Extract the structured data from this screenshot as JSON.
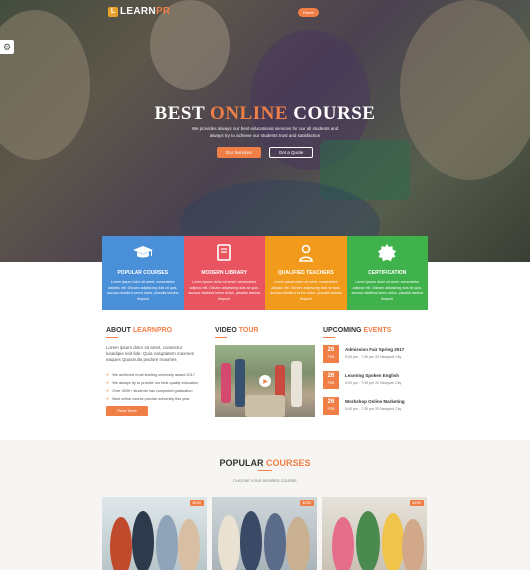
{
  "brand": {
    "mark": "L",
    "name_a": "LEARN",
    "name_b": "PR"
  },
  "nav": {
    "items": [
      "Home",
      "",
      "",
      ""
    ]
  },
  "settings_icon": "gear-icon",
  "hero": {
    "title_a": "BEST ",
    "title_highlight": "ONLINE",
    "title_b": " COURSE",
    "subtitle": "We provides always our best educational services for our all students and always try to achieve our students trust and satisfaction",
    "btn_primary": "Our Services",
    "btn_secondary": "Get a Quote"
  },
  "features": [
    {
      "title": "POPULAR COURSES",
      "icon": "graduation-cap-icon",
      "color": "#4a90d9",
      "text": "Lorem ipsum dolor sit amet, consectetur adipisic elit. Glicaec adipiscing duis sit quis, accusa nisidiera lorem dolos. pissalia lassina fimporit"
    },
    {
      "title": "MODERN LIBRARY",
      "icon": "book-icon",
      "color": "#e8545f",
      "text": "Lorem ipsum dolor sit amet, consectetur adipisic elit. Glicaec adipiscing duis sit quis, accusa nisidiera lorem dolos. pissalia lassina fimporit"
    },
    {
      "title": "QUALIFIED TEACHERS",
      "icon": "user-icon",
      "color": "#f29a1c",
      "text": "Lorem ipsum dolor sit amet, consectetur adipisic elit. Glicaec adipiscing duis sit quis, accusa nisidiera lorem dolos. pissalia lassina fimporit"
    },
    {
      "title": "CERTIFICATION",
      "icon": "badge-icon",
      "color": "#3fb24c",
      "text": "Lorem ipsum dolor sit amet, consectetur adipisic elit. Glicaec adipiscing duis sit quis, accusa nisidiera lorem dolos. pissalia lassina fimporit"
    }
  ],
  "about": {
    "title_a": "ABOUT ",
    "title_b": "LEARNPRO",
    "text": "Lorem ipsum dolor sit amet, consectur lusadipie enit lide. Quia voluptatem maxmes eaques Quasnulia pisdore maxmes",
    "list": [
      "We achieved most leading university award 2017",
      "We always try to provide our best quality education",
      "Over 3000+ students has completed graduation",
      "Best online course provide university this year"
    ],
    "button": "Read More"
  },
  "video": {
    "title_a": "VIDEO ",
    "title_b": "TOUR"
  },
  "events": {
    "title_a": "UPCOMING ",
    "title_b": "EVENTS",
    "items": [
      {
        "day": "26",
        "month": "FEB",
        "title": "Admission Fair Spring 2017",
        "info": "5:00 pm - 7:30 pm  20 Newyork City"
      },
      {
        "day": "26",
        "month": "FEB",
        "title": "Learning Spoken English",
        "info": "5:00 pm - 7:30 pm  20 Newyork City"
      },
      {
        "day": "26",
        "month": "FEB",
        "title": "Workshop Online Marketing",
        "info": "5:00 pm - 7:30 pm  20 Newyork City"
      }
    ]
  },
  "popular": {
    "title_a": "POPULAR ",
    "title_b": "COURSES",
    "subtitle": "CHOOSE YOUR DESIRED COURSE",
    "courses": [
      {
        "price": "$290"
      },
      {
        "price": "$290"
      },
      {
        "price": "$290"
      }
    ]
  }
}
